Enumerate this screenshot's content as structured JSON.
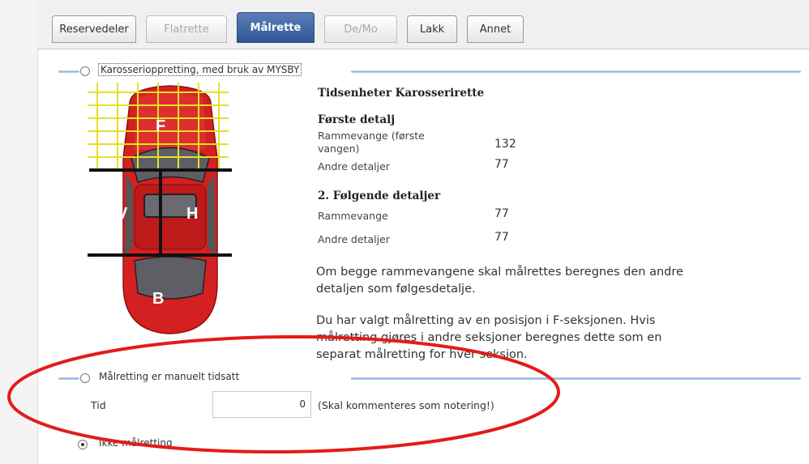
{
  "tabs": [
    {
      "label": "Reservedeler",
      "state": "normal"
    },
    {
      "label": "Flatrette",
      "state": "disabled"
    },
    {
      "label": "Målrette",
      "state": "active"
    },
    {
      "label": "De/Mo",
      "state": "disabled"
    },
    {
      "label": "Lakk",
      "state": "normal"
    },
    {
      "label": "Annet",
      "state": "normal"
    }
  ],
  "section1": {
    "radio_label": "Karosserioppretting, med bruk av MYSBY",
    "car_zones": {
      "front": "F",
      "left": "V",
      "right": "H",
      "back": "B"
    },
    "heading": "Tidsenheter Karosserirette",
    "first_detail": {
      "heading": "Første detalj",
      "rows": [
        {
          "label": "Rammevange (første vangen)",
          "value": "132"
        },
        {
          "label": "Andre detaljer",
          "value": "77"
        }
      ]
    },
    "following_details": {
      "heading": "2. Følgende detaljer",
      "rows": [
        {
          "label": "Rammevange",
          "value": "77"
        },
        {
          "label": "Andre detaljer",
          "value": "77"
        }
      ]
    },
    "note1": "Om begge rammevangene skal målrettes beregnes den andre detaljen som følgesdetalje.",
    "note2": "Du har valgt målretting av en posisjon i F-seksjonen. Hvis målretting gjøres i andre seksjoner beregnes dette som en separat målretting for hver seksjon."
  },
  "section2": {
    "radio_label": "Målretting er manuelt tidsatt",
    "time_label": "Tid",
    "time_value": "0",
    "time_hint": "(Skal kommenteres som notering!)"
  },
  "section3": {
    "radio_label": "Ikke målretting",
    "selected": true
  },
  "colors": {
    "annotation_ellipse": "#e31b1b",
    "car_body": "#d42020",
    "grid": "#e6e02a",
    "active_tab": "#2f5696"
  }
}
